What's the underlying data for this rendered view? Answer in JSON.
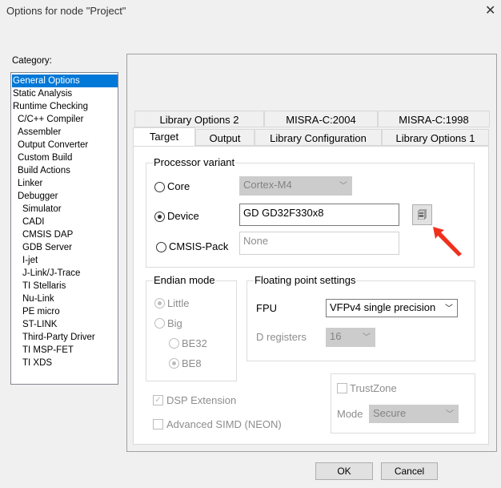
{
  "window": {
    "title": "Options for node \"Project\"",
    "close_icon": "close-icon"
  },
  "category": {
    "label": "Category:",
    "items": [
      {
        "label": "General Options",
        "level": 0,
        "selected": true
      },
      {
        "label": "Static Analysis",
        "level": 0
      },
      {
        "label": "Runtime Checking",
        "level": 0
      },
      {
        "label": "C/C++ Compiler",
        "level": 1
      },
      {
        "label": "Assembler",
        "level": 1
      },
      {
        "label": "Output Converter",
        "level": 1
      },
      {
        "label": "Custom Build",
        "level": 1
      },
      {
        "label": "Build Actions",
        "level": 1
      },
      {
        "label": "Linker",
        "level": 1
      },
      {
        "label": "Debugger",
        "level": 1
      },
      {
        "label": "Simulator",
        "level": 2
      },
      {
        "label": "CADI",
        "level": 2
      },
      {
        "label": "CMSIS DAP",
        "level": 2
      },
      {
        "label": "GDB Server",
        "level": 2
      },
      {
        "label": "I-jet",
        "level": 2
      },
      {
        "label": "J-Link/J-Trace",
        "level": 2
      },
      {
        "label": "TI Stellaris",
        "level": 2
      },
      {
        "label": "Nu-Link",
        "level": 2
      },
      {
        "label": "PE micro",
        "level": 2
      },
      {
        "label": "ST-LINK",
        "level": 2
      },
      {
        "label": "Third-Party Driver",
        "level": 2
      },
      {
        "label": "TI MSP-FET",
        "level": 2
      },
      {
        "label": "TI XDS",
        "level": 2
      }
    ]
  },
  "tabs": {
    "row1": [
      "Library Options 2",
      "MISRA-C:2004",
      "MISRA-C:1998"
    ],
    "row2": [
      "Target",
      "Output",
      "Library Configuration",
      "Library Options 1"
    ],
    "active": "Target"
  },
  "processor": {
    "title": "Processor variant",
    "core_label": "Core",
    "core_value": "Cortex-M4",
    "device_label": "Device",
    "device_value": "GD GD32F330x8",
    "cmsis_label": "CMSIS-Pack",
    "cmsis_value": "None",
    "selected": "Device"
  },
  "endian": {
    "title": "Endian mode",
    "little": "Little",
    "big": "Big",
    "be32": "BE32",
    "be8": "BE8"
  },
  "fp": {
    "title": "Floating point settings",
    "fpu_label": "FPU",
    "fpu_value": "VFPv4 single precision",
    "dreg_label": "D registers",
    "dreg_value": "16"
  },
  "dsp": {
    "label": "DSP Extension",
    "checked": true
  },
  "simd": {
    "label": "Advanced SIMD (NEON)",
    "checked": false
  },
  "trustzone": {
    "label": "TrustZone",
    "mode_label": "Mode",
    "mode_value": "Secure"
  },
  "buttons": {
    "ok": "OK",
    "cancel": "Cancel"
  },
  "colors": {
    "selection": "#0078d7",
    "arrow": "#f0301e"
  }
}
